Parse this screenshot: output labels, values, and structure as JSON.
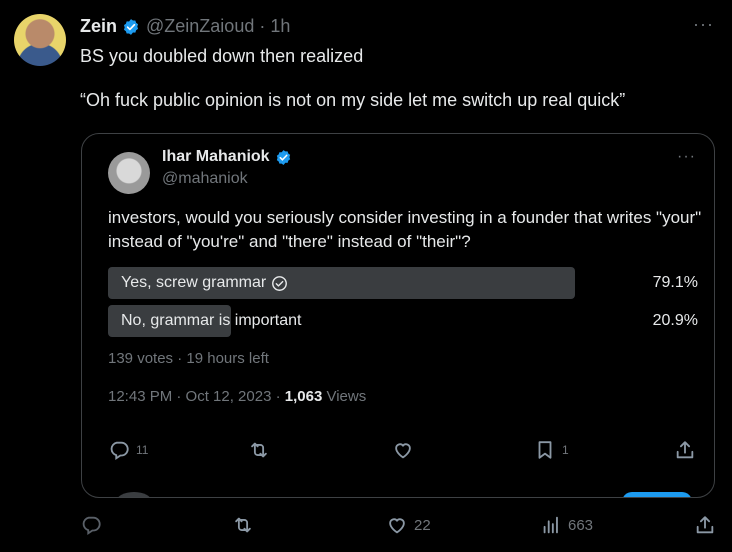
{
  "tweet": {
    "author_name": "Zein",
    "author_handle": "@ZeinZaioud",
    "dot": "·",
    "time": "1h",
    "more": "···",
    "text_line1": "BS you doubled down then realized",
    "text_line2": "“Oh fuck public opinion is not on my side let me switch up real quick”"
  },
  "quote": {
    "author_name": "Ihar Mahaniok",
    "author_handle": "@mahaniok",
    "more": "···",
    "text": "investors, would you seriously consider investing in a founder that writes \"your\" instead of \"you're\" and \"there\" instead of \"their\"?",
    "poll": {
      "options": [
        {
          "label": "Yes, screw grammar",
          "percent_label": "79.1%",
          "fraction": 0.791,
          "winner": true
        },
        {
          "label": "No, grammar is important",
          "percent_label": "20.9%",
          "fraction": 0.209,
          "winner": false
        }
      ],
      "meta": "139 votes · 19 hours left"
    },
    "timestamp": "12:43 PM · Oct 12, 2023 · ",
    "views_count": "1,063",
    "views_label": " Views",
    "actions": {
      "replies": "11",
      "retweets": "",
      "likes": "",
      "bookmarks": "1"
    }
  },
  "main_actions": {
    "replies": "",
    "retweets": "",
    "likes": "22",
    "views": "663"
  },
  "colors": {
    "background": "#000000",
    "text": "#e7e9ea",
    "muted": "#71767b",
    "verified": "#1d9bf0",
    "poll_bar": "#3a3d40"
  }
}
